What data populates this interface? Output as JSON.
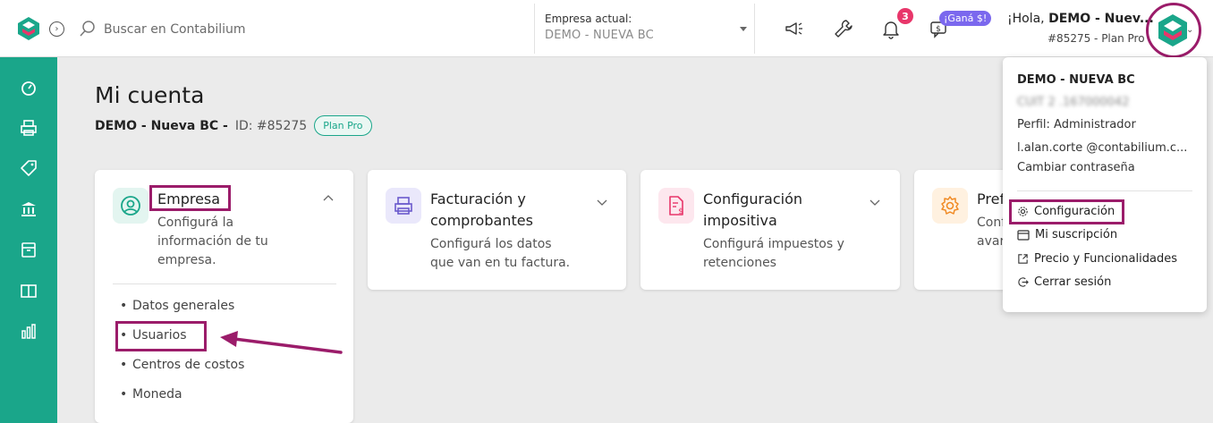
{
  "colors": {
    "brand_green": "#1aa68a",
    "highlight": "#9b1c6a",
    "badge_pink": "#e8366a",
    "promo_purple": "#7b68ee"
  },
  "header": {
    "search_placeholder": "Buscar en Contabilium",
    "company_label": "Empresa actual:",
    "company_value": "DEMO - NUEVA BC",
    "notification_count": "3",
    "promo_badge": "¡Ganá $!",
    "greeting_prefix": "¡Hola, ",
    "greeting_name": "DEMO - Nuev...",
    "account_line": "#85275 - Plan Pro"
  },
  "sidebar": {
    "items": [
      "dashboard-icon",
      "printer-icon",
      "tag-icon",
      "bank-icon",
      "archive-icon",
      "book-icon",
      "reports-icon"
    ]
  },
  "page": {
    "title": "Mi cuenta",
    "company_name": "DEMO - Nueva BC -",
    "id_text": "ID: #85275",
    "plan": "Plan Pro"
  },
  "cards": [
    {
      "title": "Empresa",
      "description_lines": [
        "Configurá la",
        "información de tu",
        "empresa."
      ],
      "icon": "user-circle-icon",
      "expanded": true,
      "items": [
        "Datos generales",
        "Usuarios",
        "Centros de costos",
        "Moneda"
      ]
    },
    {
      "title_lines": [
        "Facturación y",
        "comprobantes"
      ],
      "description_lines": [
        "Configurá los datos",
        "que van en tu factura."
      ],
      "icon": "printer-icon"
    },
    {
      "title_lines": [
        "Configuración",
        "impositiva"
      ],
      "description_lines": [
        "Configurá impuestos y",
        "retenciones"
      ],
      "icon": "tax-document-icon"
    },
    {
      "title": "Pref",
      "description_lines": [
        "Conf",
        "avar"
      ],
      "icon": "gear-icon"
    }
  ],
  "dropdown": {
    "name": "DEMO - NUEVA BC",
    "cuit": "CUIT 2  .167000042",
    "profile": "Perfil: Administrador",
    "email": "l.alan.corte  @contabilium.c...",
    "change_password": "Cambiar contraseña",
    "links": [
      "Configuración",
      "Mi suscripción",
      "Precio y Funcionalidades",
      "Cerrar sesión"
    ]
  }
}
